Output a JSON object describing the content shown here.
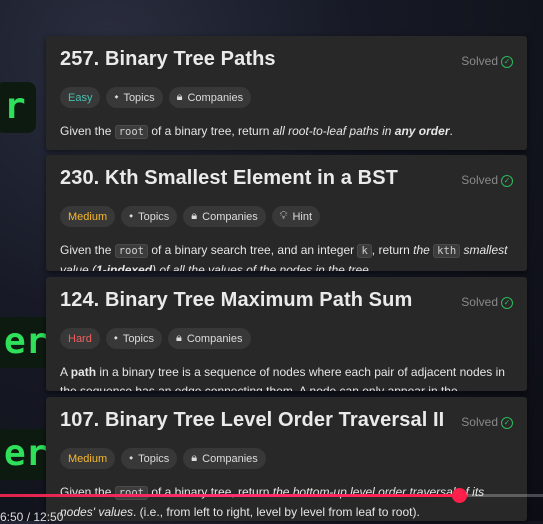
{
  "background_words": [
    "r",
    "er",
    "er"
  ],
  "cards": [
    {
      "title": "257. Binary Tree Paths",
      "status": "Solved",
      "difficulty": "Easy",
      "tags": [
        "Topics",
        "Companies"
      ],
      "desc": {
        "p1": "Given the ",
        "code1": "root",
        "p2": " of a binary tree, return ",
        "em1": "all root-to-leaf paths in ",
        "strong_em1": "any order",
        "p3": "."
      }
    },
    {
      "title": "230. Kth Smallest Element in a BST",
      "status": "Solved",
      "difficulty": "Medium",
      "tags": [
        "Topics",
        "Companies",
        "Hint"
      ],
      "desc": {
        "p1": "Given the ",
        "code1": "root",
        "p2": " of a binary search tree, and an integer ",
        "code2": "k",
        "p3": ", return ",
        "em1": "the ",
        "code3": "kth",
        "em2": " smallest value (",
        "strong_em1": "1-indexed",
        "em3": ") of all the values of the nodes in the tree."
      }
    },
    {
      "title": "124. Binary Tree Maximum Path Sum",
      "status": "Solved",
      "difficulty": "Hard",
      "tags": [
        "Topics",
        "Companies"
      ],
      "desc": {
        "p1": "A ",
        "strong1": "path",
        "p2": " in a binary tree is a sequence of nodes where each pair of adjacent nodes in the sequence has an edge connecting them. A node can only appear in the"
      }
    },
    {
      "title": "107. Binary Tree Level Order Traversal II",
      "status": "Solved",
      "difficulty": "Medium",
      "tags": [
        "Topics",
        "Companies"
      ],
      "desc": {
        "p1": "Given the ",
        "code1": "root",
        "p2": " of a binary tree, return ",
        "em1": "the bottom-up level order traversal of its nodes' values",
        "p3": ". (i.e., from left to right, level by level from leaf to root)."
      }
    }
  ],
  "player": {
    "progress": 0.845,
    "time": "6:50 / 12:50"
  },
  "colors": {
    "easy": "#45c0b0",
    "medium": "#f5b82e",
    "hard": "#f0605f",
    "solved_check": "#2cbb5d",
    "progress": "#ff1f4a"
  }
}
